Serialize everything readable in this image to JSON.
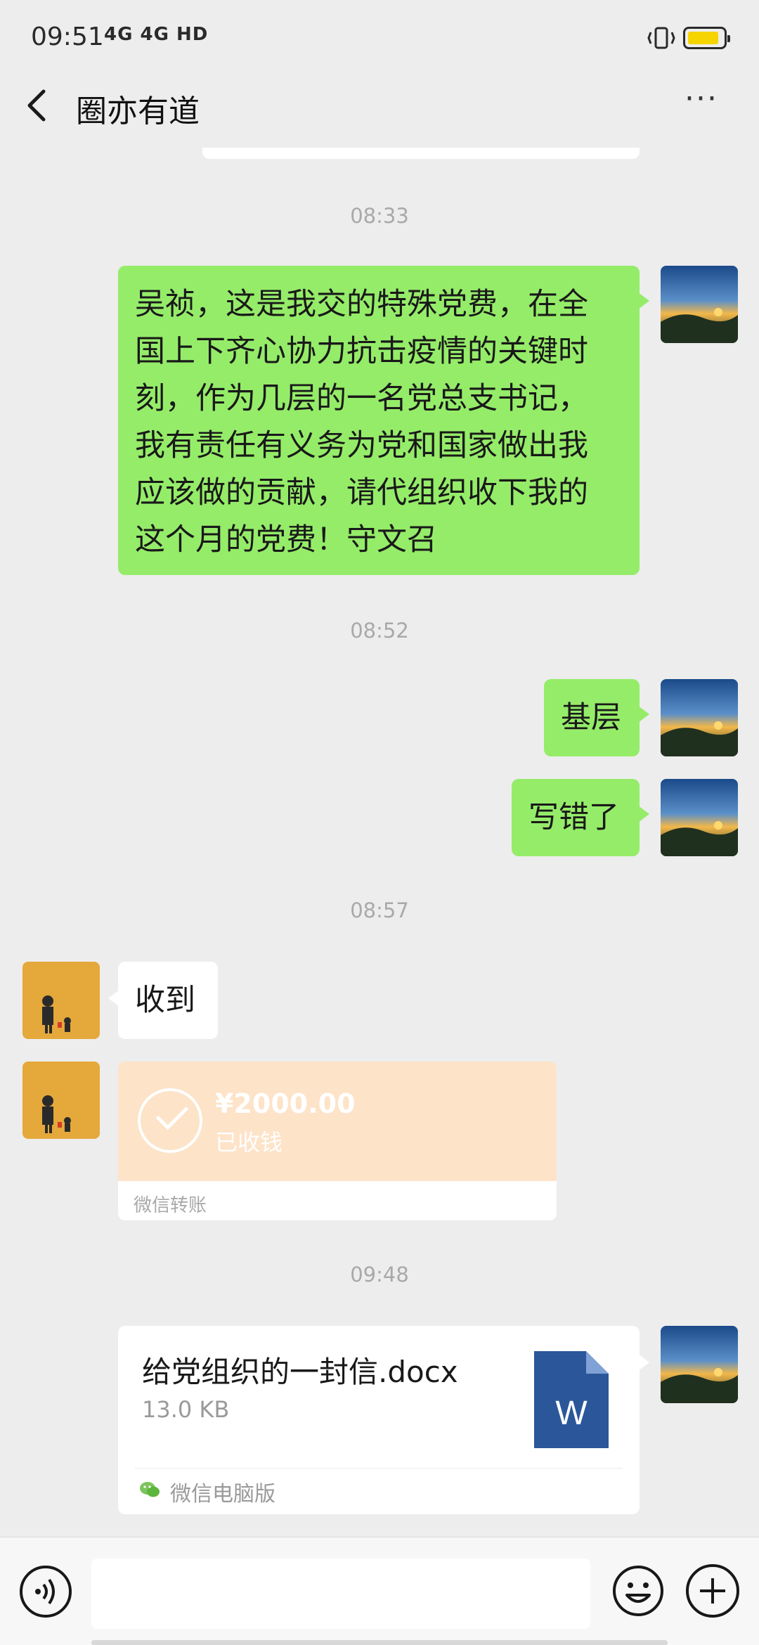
{
  "status_bar": {
    "time": "09:51",
    "network": "4G 4G HD",
    "battery_percent": 90
  },
  "header": {
    "title": "圈亦有道",
    "more_label": "···"
  },
  "messages": [
    {
      "timestamp": "08:33"
    },
    {
      "sender": "self",
      "text": [
        "吴祯，这是我交的特殊党费，在全",
        "国上下齐心协力抗击疫情的关键时",
        "刻，作为几层的一名党总支书记，",
        "我有责任有义务为党和国家做出我",
        "应该做的贡献，请代组织收下我的",
        "这个月的党费！守文召"
      ]
    },
    {
      "timestamp": "08:52"
    },
    {
      "sender": "self",
      "text": "基层"
    },
    {
      "sender": "self",
      "text": "写错了"
    },
    {
      "timestamp": "08:57"
    },
    {
      "sender": "other",
      "text": "收到"
    },
    {
      "sender": "other",
      "transfer": {
        "amount": "¥2000.00",
        "status": "已收钱",
        "source": "微信转账"
      }
    },
    {
      "timestamp": "09:48"
    },
    {
      "sender": "self",
      "file": {
        "name": "给党组织的一封信.docx",
        "size": "13.0 KB",
        "icon_letter": "W",
        "source": "微信电脑版"
      }
    }
  ],
  "colors": {
    "self_bubble": "#95ec69",
    "background": "#ededed",
    "transfer_card": "#fde3c8",
    "word_blue": "#2b579a"
  },
  "icons": {
    "back": "chevron-left-icon",
    "more": "more-dots-icon",
    "voice": "voice-icon",
    "emoji": "emoji-icon",
    "plus": "plus-icon"
  }
}
